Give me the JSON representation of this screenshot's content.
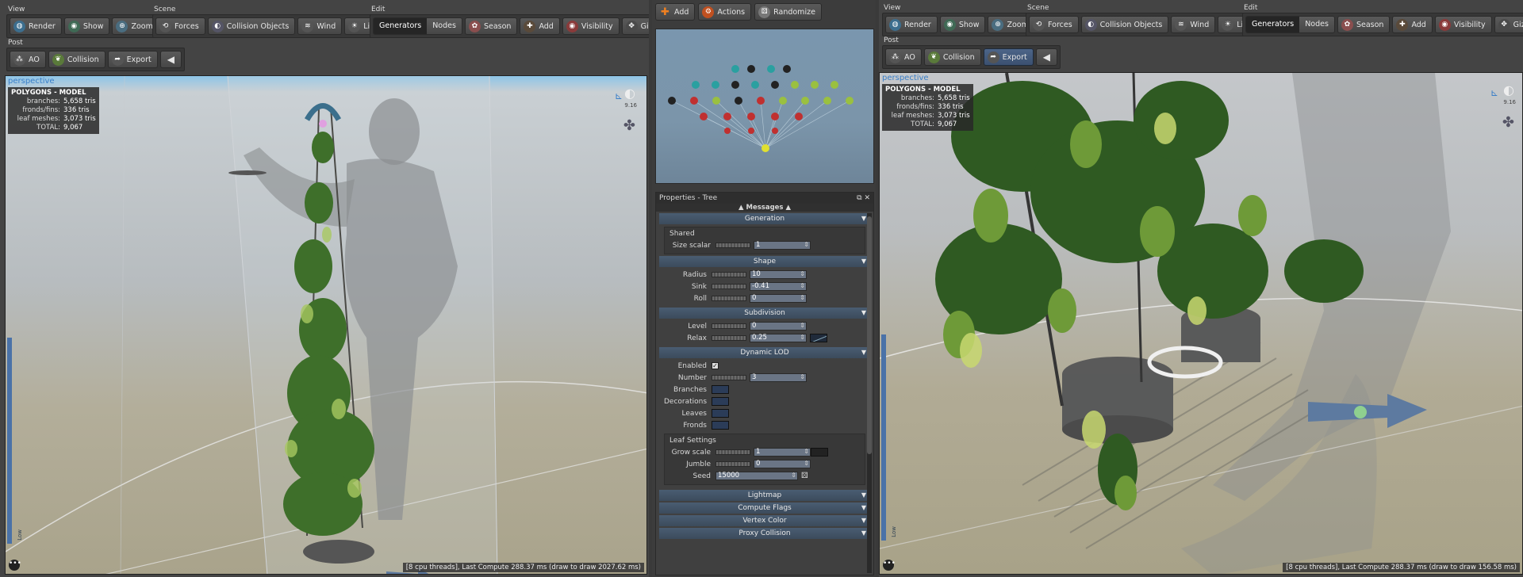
{
  "toolbar": {
    "view_label": "View",
    "scene_label": "Scene",
    "edit_label": "Edit",
    "post_label": "Post",
    "view_buttons": [
      "Render",
      "Show",
      "Zoom"
    ],
    "scene_buttons": [
      "Forces",
      "Collision Objects",
      "Wind",
      "Light"
    ],
    "edit_tabs": [
      "Generators",
      "Nodes"
    ],
    "edit_buttons": [
      "Season",
      "Add",
      "Visibility",
      "Gizmo"
    ],
    "post_buttons": [
      "AO",
      "Collision",
      "Export"
    ]
  },
  "left_viewport": {
    "label": "perspective",
    "stats": {
      "header": "POLYGONS - MODEL",
      "rows": [
        {
          "k": "branches:",
          "v": "5,658 tris"
        },
        {
          "k": "fronds/fins:",
          "v": "336 tris"
        },
        {
          "k": "leaf meshes:",
          "v": "3,073 tris"
        },
        {
          "k": "TOTAL:",
          "v": "9,067"
        }
      ]
    },
    "status": "[8 cpu threads], Last Compute 288.37 ms (draw to draw 2027.62 ms)",
    "camera_value": "9.16",
    "side_label": "Low"
  },
  "right_viewport": {
    "label": "perspective",
    "stats": {
      "header": "POLYGONS - MODEL",
      "rows": [
        {
          "k": "branches:",
          "v": "5,658 tris"
        },
        {
          "k": "fronds/fins:",
          "v": "336 tris"
        },
        {
          "k": "leaf meshes:",
          "v": "3,073 tris"
        },
        {
          "k": "TOTAL:",
          "v": "9,067"
        }
      ]
    },
    "status": "[8 cpu threads], Last Compute 288.37 ms (draw to draw 156.58 ms)",
    "camera_value": "9.16",
    "side_label": "Low"
  },
  "node_toolbar": {
    "add": "Add",
    "actions": "Actions",
    "randomize": "Randomize"
  },
  "properties": {
    "title": "Properties - Tree",
    "messages": "Messages",
    "sections": {
      "generation": "Generation",
      "shape": "Shape",
      "subdivision": "Subdivision",
      "dynamic_lod": "Dynamic LOD",
      "lightmap": "Lightmap",
      "compute_flags": "Compute Flags",
      "vertex_color": "Vertex Color",
      "proxy_collision": "Proxy Collision"
    },
    "shared_label": "Shared",
    "size_scalar": {
      "label": "Size scalar",
      "value": "1"
    },
    "radius": {
      "label": "Radius",
      "value": "10"
    },
    "sink": {
      "label": "Sink",
      "value": "-0.41"
    },
    "roll": {
      "label": "Roll",
      "value": "0"
    },
    "level": {
      "label": "Level",
      "value": "0"
    },
    "relax": {
      "label": "Relax",
      "value": "0.25"
    },
    "enabled": {
      "label": "Enabled",
      "value": "✓"
    },
    "number": {
      "label": "Number",
      "value": "3"
    },
    "branches_label": "Branches",
    "decorations_label": "Decorations",
    "leaves_label": "Leaves",
    "fronds_label": "Fronds",
    "leaf_settings_label": "Leaf Settings",
    "grow_scale": {
      "label": "Grow scale",
      "value": "1"
    },
    "jumble": {
      "label": "Jumble",
      "value": "0"
    },
    "seed": {
      "label": "Seed",
      "value": "15000"
    }
  },
  "colors": {
    "accent_blue": "#3a7fc8",
    "panel": "#444444",
    "section_header": "#4a5d72",
    "field": "#6a7585"
  }
}
